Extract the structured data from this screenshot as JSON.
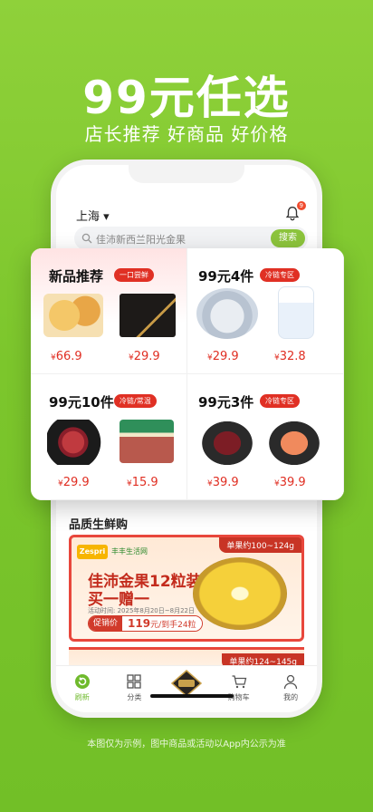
{
  "hero": {
    "title": "99元任选",
    "subtitle": "店长推荐 好商品 好价格"
  },
  "app": {
    "location": "上海 ▾",
    "bell_badge": "9",
    "search_placeholder": "佳沛新西兰阳光金果",
    "search_button": "搜索",
    "section_title": "品质生鲜购"
  },
  "grid": [
    {
      "title": "新品推荐",
      "badge": "一口尝鲜",
      "prices": [
        "66.9",
        "29.9"
      ]
    },
    {
      "title": "99元4件",
      "badge": "冷链专区",
      "prices": [
        "29.9",
        "32.8"
      ]
    },
    {
      "title": "99元10件",
      "badge": "冷链/常温",
      "prices": [
        "29.9",
        "15.9"
      ]
    },
    {
      "title": "99元3件",
      "badge": "冷链专区",
      "prices": [
        "39.9",
        "39.9"
      ]
    }
  ],
  "currency": "¥",
  "banner": {
    "tag": "单果约100~124g",
    "logo": "Zespri",
    "store": "丰丰生活网",
    "headline1": "佳沛金果12粒装",
    "headline2": "买一赠一",
    "date": "活动时间: 2025年8月20日~8月22日",
    "price_label": "促销价",
    "price_value": "119",
    "price_unit": "元/到手24粒"
  },
  "banner2": {
    "tag": "单果约124~145g"
  },
  "tabbar": [
    "刷新",
    "分类",
    "",
    "购物车",
    "我的"
  ],
  "disclaimer": "本图仅为示例，图中商品或活动以App内公示为准",
  "colors": {
    "brand_green": "#7cc62c",
    "price_red": "#e02e22"
  }
}
